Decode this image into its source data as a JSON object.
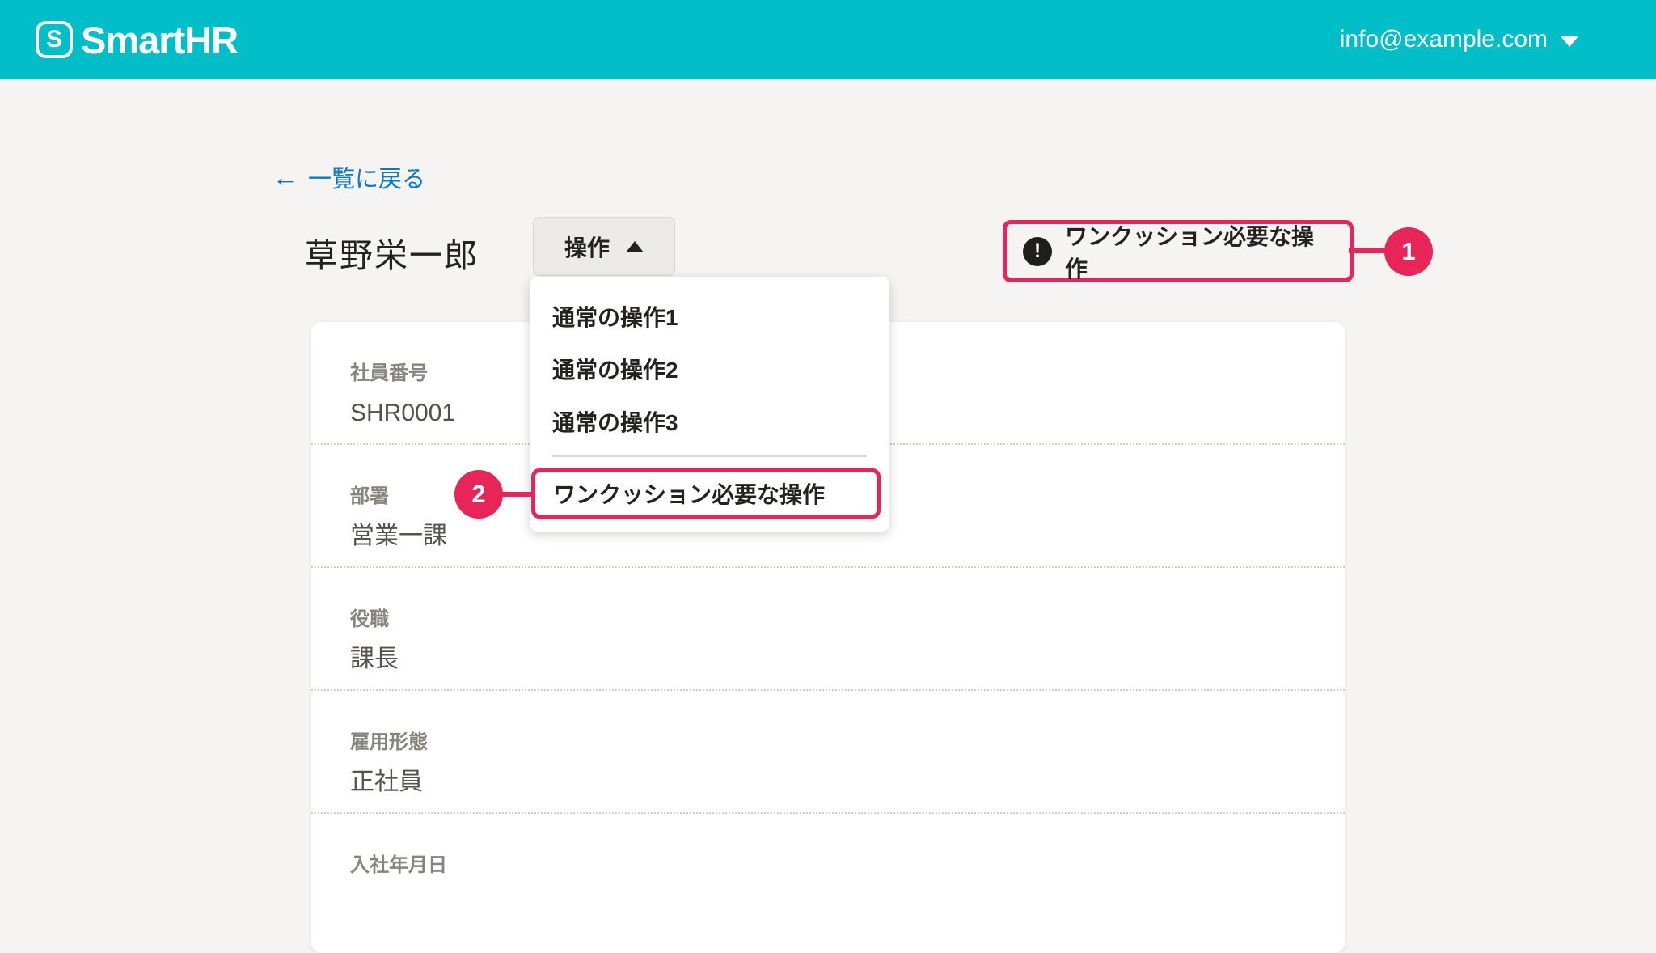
{
  "colors": {
    "brand_teal": "#00bec8",
    "annotation_pink": "#e82558",
    "link_blue": "#0b78c2",
    "text_dark": "#232220",
    "text_gray": "#54524b",
    "label_gray": "#87847c"
  },
  "header": {
    "brand": "SmartHR",
    "logo_letter": "S",
    "account_email": "info@example.com"
  },
  "page": {
    "back_link_label": "一覧に戻る",
    "title": "草野栄一郎"
  },
  "action_menu": {
    "button_label": "操作",
    "items": [
      "通常の操作1",
      "通常の操作2",
      "通常の操作3"
    ],
    "cautioned_item": "ワンクッション必要な操作"
  },
  "callout": {
    "text": "ワンクッション必要な操作"
  },
  "annotations": {
    "badge_1": "1",
    "badge_2": "2"
  },
  "profile_card": {
    "fields": [
      {
        "label": "社員番号",
        "value": "SHR0001"
      },
      {
        "label": "部署",
        "value": "営業一課"
      },
      {
        "label": "役職",
        "value": "課長"
      },
      {
        "label": "雇用形態",
        "value": "正社員"
      },
      {
        "label": "入社年月日",
        "value": ""
      }
    ]
  }
}
